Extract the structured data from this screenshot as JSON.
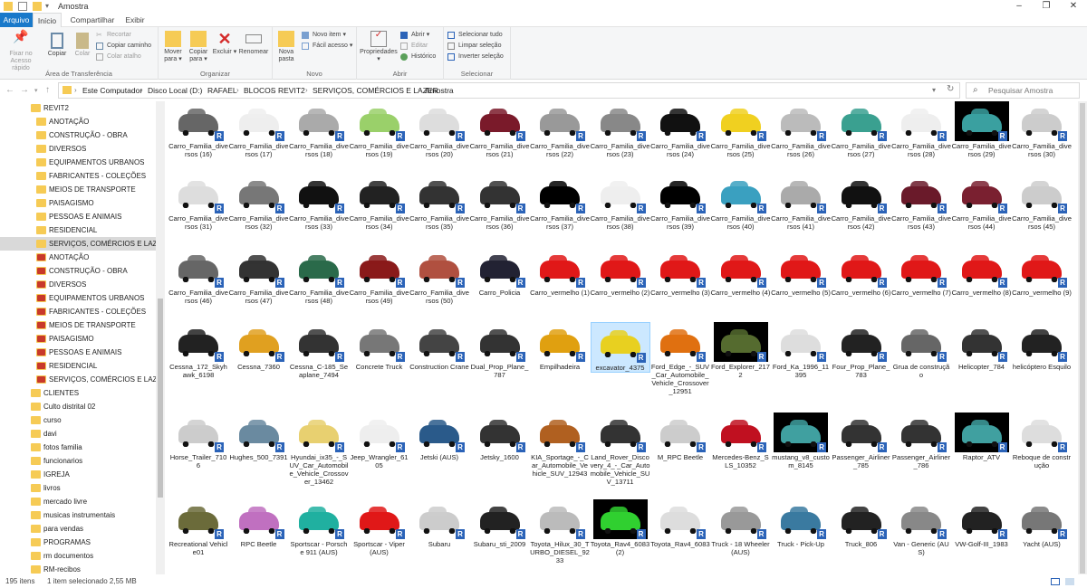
{
  "window": {
    "title": "Amostra"
  },
  "tabs": [
    "Arquivo",
    "Início",
    "Compartilhar",
    "Exibir"
  ],
  "ribbon": {
    "clipboard": {
      "pin": "Fixar no Acesso rápido",
      "copy": "Copiar",
      "paste": "Colar",
      "cut": "Recortar",
      "copy_path": "Copiar caminho",
      "paste_shortcut": "Colar atalho",
      "group": "Área de Transferência"
    },
    "organize": {
      "move": "Mover para",
      "copy_to": "Copiar para",
      "delete": "Excluir",
      "rename": "Renomear",
      "group": "Organizar"
    },
    "new": {
      "folder": "Nova pasta",
      "new_item": "Novo item",
      "easy_access": "Fácil acesso",
      "group": "Novo"
    },
    "open": {
      "properties": "Propriedades",
      "open": "Abrir",
      "edit": "Editar",
      "history": "Histórico",
      "group": "Abrir"
    },
    "select": {
      "all": "Selecionar tudo",
      "none": "Limpar seleção",
      "invert": "Inverter seleção",
      "group": "Selecionar"
    }
  },
  "address": {
    "crumbs": [
      "Este Computador",
      "Disco Local (D:)",
      "RAFAEL",
      "BLOCOS",
      "REVIT2",
      "SERVIÇOS, COMÉRCIOS E LAZER",
      "Amostra"
    ],
    "search_placeholder": "Pesquisar Amostra"
  },
  "sidebar": [
    {
      "label": "REVIT2",
      "indent": 1,
      "type": "folder"
    },
    {
      "label": "ANOTAÇÃO",
      "indent": 2,
      "type": "folder"
    },
    {
      "label": "CONSTRUÇÃO - OBRA",
      "indent": 2,
      "type": "folder"
    },
    {
      "label": "DIVERSOS",
      "indent": 2,
      "type": "folder"
    },
    {
      "label": "EQUIPAMENTOS URBANOS",
      "indent": 2,
      "type": "folder"
    },
    {
      "label": "FABRICANTES - COLEÇÕES",
      "indent": 2,
      "type": "folder"
    },
    {
      "label": "MEIOS DE TRANSPORTE",
      "indent": 2,
      "type": "folder"
    },
    {
      "label": "PAISAGISMO",
      "indent": 2,
      "type": "folder"
    },
    {
      "label": "PESSOAS E ANIMAIS",
      "indent": 2,
      "type": "folder"
    },
    {
      "label": "RESIDENCIAL",
      "indent": 2,
      "type": "folder"
    },
    {
      "label": "SERVIÇOS, COMÉRCIOS E LAZER",
      "indent": 2,
      "type": "folder",
      "selected": true
    },
    {
      "label": "ANOTAÇÃO",
      "indent": 2,
      "type": "sync"
    },
    {
      "label": "CONSTRUÇÃO - OBRA",
      "indent": 2,
      "type": "sync"
    },
    {
      "label": "DIVERSOS",
      "indent": 2,
      "type": "sync"
    },
    {
      "label": "EQUIPAMENTOS URBANOS",
      "indent": 2,
      "type": "sync"
    },
    {
      "label": "FABRICANTES - COLEÇÕES",
      "indent": 2,
      "type": "sync"
    },
    {
      "label": "MEIOS DE TRANSPORTE",
      "indent": 2,
      "type": "sync"
    },
    {
      "label": "PAISAGISMO",
      "indent": 2,
      "type": "sync"
    },
    {
      "label": "PESSOAS E ANIMAIS",
      "indent": 2,
      "type": "sync"
    },
    {
      "label": "RESIDENCIAL",
      "indent": 2,
      "type": "sync"
    },
    {
      "label": "SERVIÇOS, COMÉRCIOS E LAZER",
      "indent": 2,
      "type": "sync"
    },
    {
      "label": "CLIENTES",
      "indent": 1,
      "type": "folder"
    },
    {
      "label": "Culto distrital 02",
      "indent": 1,
      "type": "folder"
    },
    {
      "label": "curso",
      "indent": 1,
      "type": "folder"
    },
    {
      "label": "davi",
      "indent": 1,
      "type": "folder"
    },
    {
      "label": "fotos familia",
      "indent": 1,
      "type": "folder"
    },
    {
      "label": "funcionarios",
      "indent": 1,
      "type": "folder"
    },
    {
      "label": "IGREJA",
      "indent": 1,
      "type": "folder"
    },
    {
      "label": "livros",
      "indent": 1,
      "type": "folder"
    },
    {
      "label": "mercado livre",
      "indent": 1,
      "type": "folder"
    },
    {
      "label": "musicas instrumentais",
      "indent": 1,
      "type": "folder"
    },
    {
      "label": "para vendas",
      "indent": 1,
      "type": "folder"
    },
    {
      "label": "PROGRAMAS",
      "indent": 1,
      "type": "folder"
    },
    {
      "label": "rm documentos",
      "indent": 1,
      "type": "folder"
    },
    {
      "label": "RM-recibos",
      "indent": 1,
      "type": "folder"
    }
  ],
  "items": [
    {
      "label": "Carro_Familia_diversos (16)",
      "color": "#666"
    },
    {
      "label": "Carro_Familia_diversos (17)",
      "color": "#eee"
    },
    {
      "label": "Carro_Familia_diversos (18)",
      "color": "#aaa"
    },
    {
      "label": "Carro_Familia_diversos (19)",
      "color": "#9ad06a"
    },
    {
      "label": "Carro_Familia_diversos (20)",
      "color": "#ddd"
    },
    {
      "label": "Carro_Familia_diversos (21)",
      "color": "#7a1a2a"
    },
    {
      "label": "Carro_Familia_diversos (22)",
      "color": "#999"
    },
    {
      "label": "Carro_Familia_diversos (23)",
      "color": "#888"
    },
    {
      "label": "Carro_Familia_diversos (24)",
      "color": "#111"
    },
    {
      "label": "Carro_Familia_diversos (25)",
      "color": "#f0d020"
    },
    {
      "label": "Carro_Familia_diversos (26)",
      "color": "#bbb"
    },
    {
      "label": "Carro_Familia_diversos (27)",
      "color": "#3aa090"
    },
    {
      "label": "Carro_Familia_diversos (28)",
      "color": "#eee"
    },
    {
      "label": "Carro_Familia_diversos (29)",
      "color": "#3aa0a0",
      "dark": true
    },
    {
      "label": "Carro_Familia_diversos (30)",
      "color": "#ccc"
    },
    {
      "label": "Carro_Familia_diversos (31)",
      "color": "#ddd"
    },
    {
      "label": "Carro_Familia_diversos (32)",
      "color": "#777"
    },
    {
      "label": "Carro_Familia_diversos (33)",
      "color": "#111"
    },
    {
      "label": "Carro_Familia_diversos (34)",
      "color": "#222"
    },
    {
      "label": "Carro_Familia_diversos (35)",
      "color": "#333"
    },
    {
      "label": "Carro_Familia_diversos (36)",
      "color": "#333"
    },
    {
      "label": "Carro_Familia_diversos (37)",
      "color": "#000"
    },
    {
      "label": "Carro_Familia_diversos (38)",
      "color": "#eee"
    },
    {
      "label": "Carro_Familia_diversos (39)",
      "color": "#000"
    },
    {
      "label": "Carro_Familia_diversos (40)",
      "color": "#3aa0c0"
    },
    {
      "label": "Carro_Familia_diversos (41)",
      "color": "#aaa"
    },
    {
      "label": "Carro_Familia_diversos (42)",
      "color": "#111"
    },
    {
      "label": "Carro_Familia_diversos (43)",
      "color": "#6a1a2a"
    },
    {
      "label": "Carro_Familia_diversos (44)",
      "color": "#7a2030"
    },
    {
      "label": "Carro_Familia_diversos (45)",
      "color": "#ccc"
    },
    {
      "label": "Carro_Familia_diversos (46)",
      "color": "#666"
    },
    {
      "label": "Carro_Familia_diversos (47)",
      "color": "#333"
    },
    {
      "label": "Carro_Familia_diversos (48)",
      "color": "#2a6a4a"
    },
    {
      "label": "Carro_Familia_diversos (49)",
      "color": "#8a1a1a"
    },
    {
      "label": "Carro_Familia_diversos (50)",
      "color": "#b05040"
    },
    {
      "label": "Carro_Policia",
      "color": "#223"
    },
    {
      "label": "Carro_vermelho (1)",
      "color": "#e01818"
    },
    {
      "label": "Carro_vermelho (2)",
      "color": "#e01818"
    },
    {
      "label": "Carro_vermelho (3)",
      "color": "#e01818"
    },
    {
      "label": "Carro_vermelho (4)",
      "color": "#e01818"
    },
    {
      "label": "Carro_vermelho (5)",
      "color": "#e01818"
    },
    {
      "label": "Carro_vermelho (6)",
      "color": "#e01818"
    },
    {
      "label": "Carro_vermelho (7)",
      "color": "#e01818"
    },
    {
      "label": "Carro_vermelho (8)",
      "color": "#e01818"
    },
    {
      "label": "Carro_vermelho (9)",
      "color": "#e01818"
    },
    {
      "label": "Cessna_172_Skyhawk_6198",
      "color": "#222"
    },
    {
      "label": "Cessna_7360",
      "color": "#e0a020"
    },
    {
      "label": "Cessna_C-185_Seaplane_7494",
      "color": "#333"
    },
    {
      "label": "Concrete Truck",
      "color": "#777"
    },
    {
      "label": "Construction Crane",
      "color": "#444"
    },
    {
      "label": "Dual_Prop_Plane_787",
      "color": "#333"
    },
    {
      "label": "Empilhadeira",
      "color": "#e0a010"
    },
    {
      "label": "excavator_4375",
      "color": "#e8d020",
      "selected": true
    },
    {
      "label": "Ford_Edge_-_SUV_Car_Automobile_Vehicle_Crossover_12951",
      "color": "#e07010"
    },
    {
      "label": "Ford_Explorer_2172",
      "color": "#556b2f",
      "dark": true
    },
    {
      "label": "Ford_Ka_1996_11395",
      "color": "#ddd"
    },
    {
      "label": "Four_Prop_Plane_783",
      "color": "#222"
    },
    {
      "label": "Grua de construção",
      "color": "#666"
    },
    {
      "label": "Helicopter_784",
      "color": "#333"
    },
    {
      "label": "helicóptero Esquilo",
      "color": "#222"
    },
    {
      "label": "Horse_Trailer_7106",
      "color": "#ccc"
    },
    {
      "label": "Hughes_500_7391",
      "color": "#6a8aa0"
    },
    {
      "label": "Hyundai_ix35_-_SUV_Car_Automobile_Vehicle_Crossover_13462",
      "color": "#e8d070"
    },
    {
      "label": "Jeep_Wrangler_6105",
      "color": "#eee"
    },
    {
      "label": "Jetski (AUS)",
      "color": "#2a5a8a"
    },
    {
      "label": "Jetsky_1600",
      "color": "#333"
    },
    {
      "label": "KIA_Sportage_-_Car_Automobile_Vehicle_SUV_12943",
      "color": "#b06020"
    },
    {
      "label": "Land_Rover_Discovery_4_-_Car_Automobile_Vehicle_SUV_13711",
      "color": "#333"
    },
    {
      "label": "M_RPC Beetle",
      "color": "#ccc"
    },
    {
      "label": "Mercedes-Benz_SLS_10352",
      "color": "#c01020"
    },
    {
      "label": "mustang_v8_custom_8145",
      "color": "#40a0a0",
      "dark": true
    },
    {
      "label": "Passenger_Airliner_785",
      "color": "#333"
    },
    {
      "label": "Passenger_Airliner_786",
      "color": "#333"
    },
    {
      "label": "Raptor_ATV",
      "color": "#40a0a0",
      "dark": true
    },
    {
      "label": "Reboque de construção",
      "color": "#ddd"
    },
    {
      "label": "Recreational Vehicle01",
      "color": "#6b6b3a"
    },
    {
      "label": "RPC Beetle",
      "color": "#c070c0"
    },
    {
      "label": "Sportscar - Porsche 911 (AUS)",
      "color": "#20b0a0"
    },
    {
      "label": "Sportscar - Viper (AUS)",
      "color": "#e01818"
    },
    {
      "label": "Subaru",
      "color": "#ccc"
    },
    {
      "label": "Subaru_sti_2009",
      "color": "#222"
    },
    {
      "label": "Toyota_Hilux_30_TURBO_DIESEL_9233",
      "color": "#bbb"
    },
    {
      "label": "Toyota_Rav4_6083 (2)",
      "color": "#30d030",
      "dark": true
    },
    {
      "label": "Toyota_Rav4_6083",
      "color": "#ddd"
    },
    {
      "label": "Truck - 18 Wheeler (AUS)",
      "color": "#999"
    },
    {
      "label": "Truck - Pick-Up",
      "color": "#3a7aa0"
    },
    {
      "label": "Truck_806",
      "color": "#222"
    },
    {
      "label": "Van - Generic (AUS)",
      "color": "#888"
    },
    {
      "label": "VW-Golf-III_1983",
      "color": "#222"
    },
    {
      "label": "Yacht (AUS)",
      "color": "#777"
    }
  ],
  "status": {
    "count": "195 itens",
    "selection": "1 item selecionado  2,55 MB"
  }
}
